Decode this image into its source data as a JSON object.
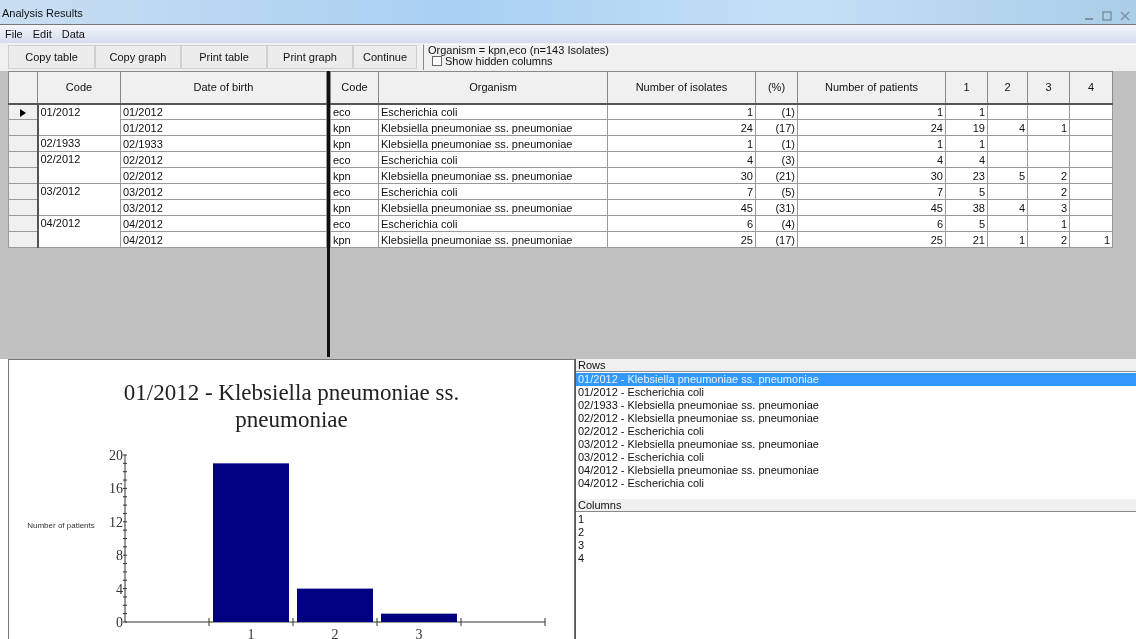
{
  "window": {
    "title": "Analysis Results"
  },
  "menu": [
    "File",
    "Edit",
    "Data"
  ],
  "toolbar": {
    "buttons": [
      "Copy table",
      "Copy graph",
      "Print table",
      "Print graph",
      "Continue"
    ],
    "info": "Organism = kpn,eco  (n=143 Isolates)",
    "show_hidden_columns": {
      "label": "Show hidden columns",
      "checked": false
    }
  },
  "table": {
    "left_columns": [
      "Code",
      "Date of birth"
    ],
    "right_columns": [
      "Code",
      "Organism",
      "Number of isolates",
      "(%)",
      "Number of patients",
      "1",
      "2",
      "3",
      "4"
    ],
    "groups": [
      {
        "code": "01/2012",
        "rows": [
          {
            "current": true,
            "date": "01/2012",
            "cells": [
              "eco",
              "Escherichia coli",
              "1",
              "(1)",
              "1",
              "1",
              "",
              "",
              ""
            ]
          },
          {
            "current": false,
            "date": "01/2012",
            "cells": [
              "kpn",
              "Klebsiella pneumoniae ss. pneumoniae",
              "24",
              "(17)",
              "24",
              "19",
              "4",
              "1",
              ""
            ]
          }
        ]
      },
      {
        "code": "02/1933",
        "rows": [
          {
            "current": false,
            "date": "02/1933",
            "cells": [
              "kpn",
              "Klebsiella pneumoniae ss. pneumoniae",
              "1",
              "(1)",
              "1",
              "1",
              "",
              "",
              ""
            ]
          }
        ]
      },
      {
        "code": "02/2012",
        "rows": [
          {
            "current": false,
            "date": "02/2012",
            "cells": [
              "eco",
              "Escherichia coli",
              "4",
              "(3)",
              "4",
              "4",
              "",
              "",
              ""
            ]
          },
          {
            "current": false,
            "date": "02/2012",
            "cells": [
              "kpn",
              "Klebsiella pneumoniae ss. pneumoniae",
              "30",
              "(21)",
              "30",
              "23",
              "5",
              "2",
              ""
            ]
          }
        ]
      },
      {
        "code": "03/2012",
        "rows": [
          {
            "current": false,
            "date": "03/2012",
            "cells": [
              "eco",
              "Escherichia coli",
              "7",
              "(5)",
              "7",
              "5",
              "",
              "2",
              ""
            ]
          },
          {
            "current": false,
            "date": "03/2012",
            "cells": [
              "kpn",
              "Klebsiella pneumoniae ss. pneumoniae",
              "45",
              "(31)",
              "45",
              "38",
              "4",
              "3",
              ""
            ]
          }
        ]
      },
      {
        "code": "04/2012",
        "rows": [
          {
            "current": false,
            "date": "04/2012",
            "cells": [
              "eco",
              "Escherichia coli",
              "6",
              "(4)",
              "6",
              "5",
              "",
              "1",
              ""
            ]
          },
          {
            "current": false,
            "date": "04/2012",
            "cells": [
              "kpn",
              "Klebsiella pneumoniae ss. pneumoniae",
              "25",
              "(17)",
              "25",
              "21",
              "1",
              "2",
              "1"
            ]
          }
        ]
      }
    ]
  },
  "graph": {
    "chart_data": {
      "type": "bar",
      "title": "01/2012 - Klebsiella pneumoniae ss. pneumoniae",
      "ylabel": "Number of patients",
      "categories": [
        "1",
        "2",
        "3"
      ],
      "values": [
        19,
        4,
        1
      ],
      "ylim": [
        0,
        20
      ],
      "yticks": [
        0,
        4,
        8,
        12,
        16,
        20
      ]
    }
  },
  "rows_list": {
    "label": "Rows",
    "items": [
      {
        "text": "01/2012 - Klebsiella pneumoniae ss. pneumoniae",
        "selected": true
      },
      {
        "text": "01/2012 - Escherichia coli",
        "selected": false
      },
      {
        "text": "02/1933 - Klebsiella pneumoniae ss. pneumoniae",
        "selected": false
      },
      {
        "text": "02/2012 - Klebsiella pneumoniae ss. pneumoniae",
        "selected": false
      },
      {
        "text": "02/2012 - Escherichia coli",
        "selected": false
      },
      {
        "text": "03/2012 - Klebsiella pneumoniae ss. pneumoniae",
        "selected": false
      },
      {
        "text": "03/2012 - Escherichia coli",
        "selected": false
      },
      {
        "text": "04/2012 - Klebsiella pneumoniae ss. pneumoniae",
        "selected": false
      },
      {
        "text": "04/2012 - Escherichia coli",
        "selected": false
      }
    ]
  },
  "columns_list": {
    "label": "Columns",
    "items": [
      {
        "text": "1",
        "selected": false
      },
      {
        "text": "2",
        "selected": false
      },
      {
        "text": "3",
        "selected": false
      },
      {
        "text": "4",
        "selected": false
      }
    ]
  }
}
